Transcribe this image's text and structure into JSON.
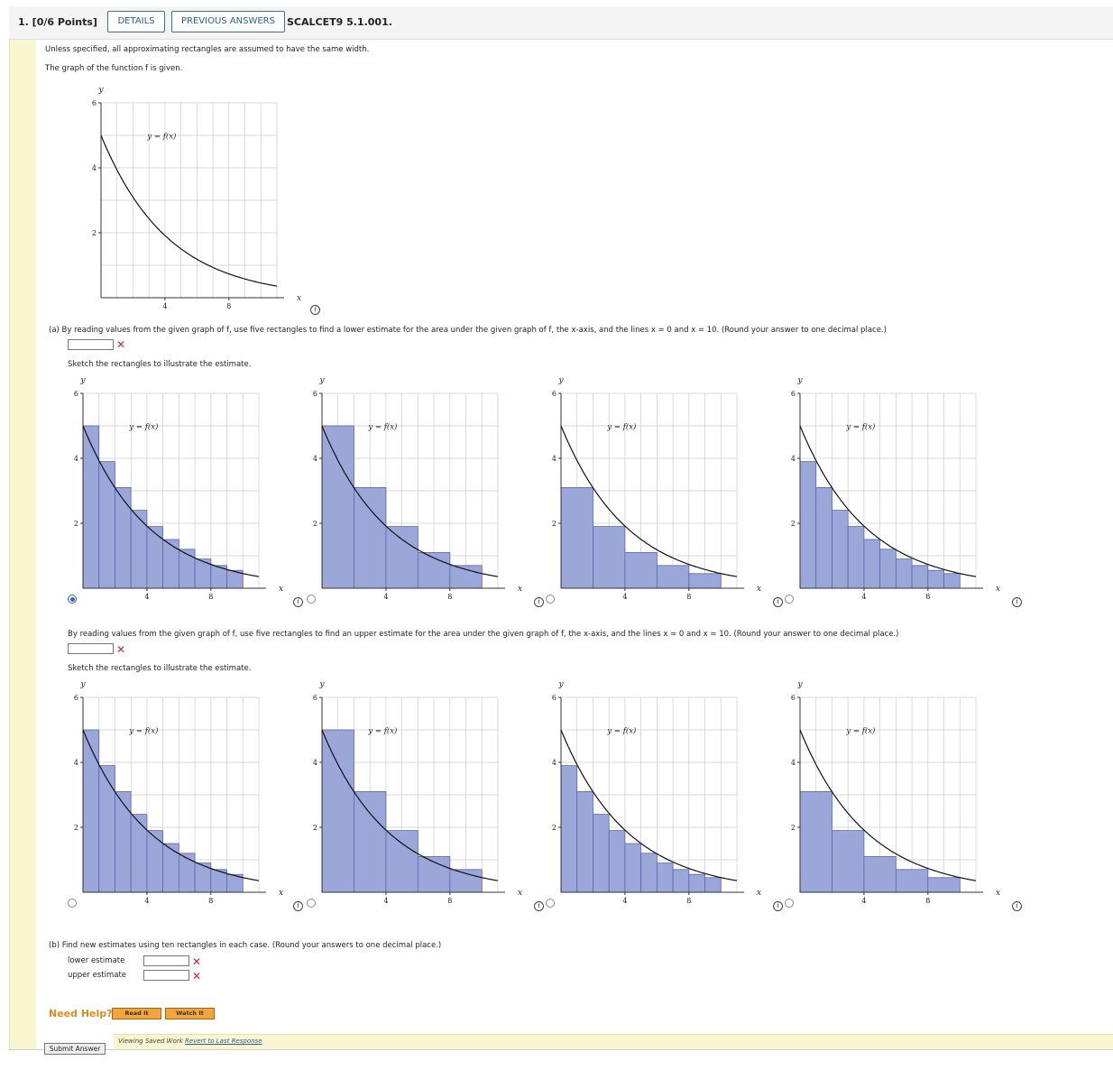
{
  "header": {
    "question_label": "1. [0/6 Points]",
    "details_button": "DETAILS",
    "previous_answers_button": "PREVIOUS ANSWERS",
    "problem_code": "SCALCET9 5.1.001."
  },
  "intro": {
    "line1": "Unless specified, all approximating rectangles are assumed to have the same width.",
    "line2": "The graph of the function f is given."
  },
  "graph_labels": {
    "y_axis": "y",
    "x_axis": "x",
    "curve_label": "y = f(x)",
    "y_ticks": [
      "2",
      "4",
      "6"
    ],
    "x_ticks": [
      "4",
      "8"
    ]
  },
  "part_a": {
    "prompt": "(a)  By reading values from the given graph of f, use five rectangles to find a lower estimate for the area under the given graph of f, the x-axis, and the lines x = 0 and x = 10. (Round your answer to one decimal place.)",
    "answer_value": "",
    "sketch_prompt": "Sketch the rectangles to illustrate the estimate.",
    "upper_prompt": "By reading values from the given graph of f, use five rectangles to find an upper estimate for the area under the given graph of f, the x-axis, and the lines x = 0 and x = 10. (Round your answer to one decimal place.)",
    "upper_answer_value": "",
    "upper_sketch_prompt": "Sketch the rectangles to illustrate the estimate."
  },
  "part_b": {
    "prompt": "(b)  Find new estimates using ten rectangles in each case. (Round your answers to one decimal place.)",
    "lower_label": "lower estimate",
    "upper_label": "upper estimate",
    "lower_value": "",
    "upper_value": ""
  },
  "help": {
    "label": "Need Help?",
    "read_it": "Read It",
    "watch_it": "Watch It"
  },
  "footer": {
    "submit": "Submit Answer",
    "saved_text": "Viewing Saved Work",
    "revert_link": "Revert to Last Response"
  },
  "colors": {
    "rect_fill": "#9ba6d9",
    "rect_stroke": "#5a67a8",
    "grid": "#cccccc",
    "error": "#d9262c"
  },
  "chart_data": [
    {
      "type": "line",
      "name": "given graph",
      "curve": "y = 5*exp(-0.24*x)",
      "x": [
        0,
        1,
        2,
        3,
        4,
        5,
        6,
        7,
        8,
        9,
        10
      ],
      "y": [
        5.0,
        3.9,
        3.1,
        2.4,
        1.9,
        1.5,
        1.2,
        0.9,
        0.7,
        0.6,
        0.45
      ],
      "xlim": [
        0,
        11
      ],
      "ylim": [
        0,
        6
      ],
      "grid": true
    },
    {
      "type": "bar",
      "name": "option A1 (selected)",
      "selected": true,
      "edges": [
        0,
        1,
        2,
        3,
        4,
        5,
        6,
        7,
        8,
        9,
        10
      ],
      "heights": [
        5.0,
        3.9,
        3.1,
        2.4,
        1.9,
        1.5,
        1.2,
        0.9,
        0.7,
        0.55
      ]
    },
    {
      "type": "bar",
      "name": "option A2",
      "selected": false,
      "edges": [
        0,
        2,
        4,
        6,
        8,
        10
      ],
      "heights": [
        5.0,
        3.1,
        1.9,
        1.1,
        0.7
      ]
    },
    {
      "type": "bar",
      "name": "option A3",
      "selected": false,
      "edges": [
        0,
        2,
        4,
        6,
        8,
        10
      ],
      "heights": [
        3.1,
        1.9,
        1.1,
        0.7,
        0.45
      ]
    },
    {
      "type": "bar",
      "name": "option A4",
      "selected": false,
      "edges": [
        0,
        1,
        2,
        3,
        4,
        5,
        6,
        7,
        8,
        9,
        10
      ],
      "heights": [
        3.9,
        3.1,
        2.4,
        1.9,
        1.5,
        1.2,
        0.9,
        0.7,
        0.55,
        0.45
      ]
    },
    {
      "type": "bar",
      "name": "option B1",
      "selected": false,
      "edges": [
        0,
        1,
        2,
        3,
        4,
        5,
        6,
        7,
        8,
        9,
        10
      ],
      "heights": [
        5.0,
        3.9,
        3.1,
        2.4,
        1.9,
        1.5,
        1.2,
        0.9,
        0.7,
        0.55
      ]
    },
    {
      "type": "bar",
      "name": "option B2",
      "selected": false,
      "edges": [
        0,
        2,
        4,
        6,
        8,
        10
      ],
      "heights": [
        5.0,
        3.1,
        1.9,
        1.1,
        0.7
      ]
    },
    {
      "type": "bar",
      "name": "option B3",
      "selected": false,
      "edges": [
        0,
        1,
        2,
        3,
        4,
        5,
        6,
        7,
        8,
        9,
        10
      ],
      "heights": [
        3.9,
        3.1,
        2.4,
        1.9,
        1.5,
        1.2,
        0.9,
        0.7,
        0.55,
        0.45
      ]
    },
    {
      "type": "bar",
      "name": "option B4",
      "selected": false,
      "edges": [
        0,
        2,
        4,
        6,
        8,
        10
      ],
      "heights": [
        3.1,
        1.9,
        1.1,
        0.7,
        0.45
      ]
    }
  ]
}
